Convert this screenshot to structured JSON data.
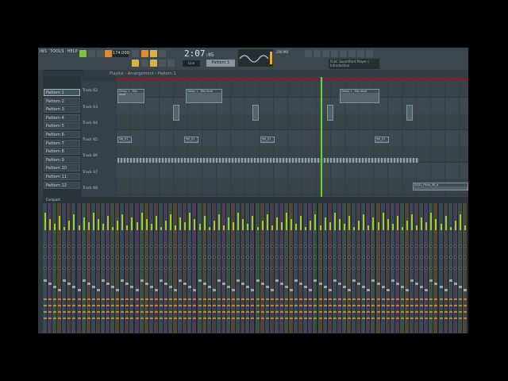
{
  "menu": [
    "INS",
    "TOOLS",
    "HELP"
  ],
  "toolbar": {
    "tempo": "174.000",
    "time": "2:07",
    "time_frac": ":05",
    "pattern": "Pattern 1",
    "snap": "Line",
    "memory": "298 MB",
    "hint_title": "FLSC SoundFont Player (",
    "hint_sub": "Introduction"
  },
  "playlist": {
    "title": "Playlist - Arrangement › Pattern 1"
  },
  "patterns": [
    "Pattern 1",
    "Pattern 2",
    "Pattern 3",
    "Pattern 4",
    "Pattern 5",
    "Pattern 6",
    "Pattern 7",
    "Pattern 8",
    "Pattern 9",
    "Pattern 10",
    "Pattern 11",
    "Pattern 12"
  ],
  "tracks": [
    "Track 62",
    "Track 63",
    "Track 64",
    "Track 65",
    "Track 66",
    "Track 67",
    "Track 68"
  ],
  "clips": {
    "a": "Delay 1 - Mix level",
    "b": "Delay 1 - Mix level",
    "c": "Delay 1 - Mix level",
    "d": "Vol_01",
    "e": "DC01_Pluto_08_d"
  },
  "mixer": {
    "label": "Compact"
  },
  "colors": {
    "accent": "#6fd13a",
    "ruler": "#6a2a36"
  }
}
